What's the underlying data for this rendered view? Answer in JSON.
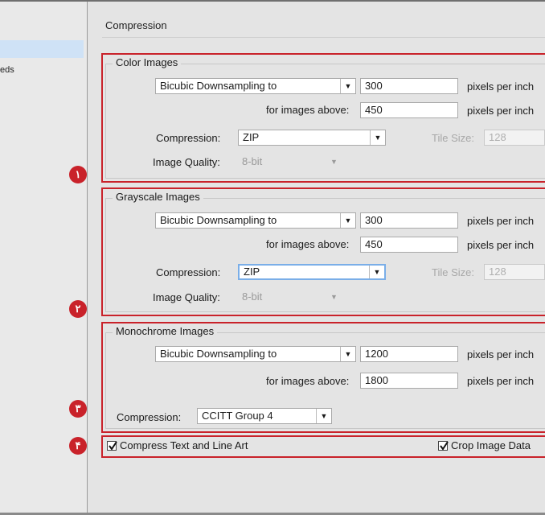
{
  "sidebar": {
    "item_partial": "eds"
  },
  "header": {
    "title": "Compression"
  },
  "color": {
    "title": "Color Images",
    "downsampling": "Bicubic Downsampling to",
    "resolution": "300",
    "res_unit": "pixels per inch",
    "above_label": "for images above:",
    "above_value": "450",
    "above_unit": "pixels per inch",
    "compression_label": "Compression:",
    "compression_value": "ZIP",
    "tile_label": "Tile Size:",
    "tile_value": "128",
    "quality_label": "Image Quality:",
    "quality_value": "8-bit",
    "badge": "١"
  },
  "gray": {
    "title": "Grayscale Images",
    "downsampling": "Bicubic Downsampling to",
    "resolution": "300",
    "res_unit": "pixels per inch",
    "above_label": "for images above:",
    "above_value": "450",
    "above_unit": "pixels per inch",
    "compression_label": "Compression:",
    "compression_value": "ZIP",
    "tile_label": "Tile Size:",
    "tile_value": "128",
    "quality_label": "Image Quality:",
    "quality_value": "8-bit",
    "badge": "٢"
  },
  "mono": {
    "title": "Monochrome Images",
    "downsampling": "Bicubic Downsampling to",
    "resolution": "1200",
    "res_unit": "pixels per inch",
    "above_label": "for images above:",
    "above_value": "1800",
    "above_unit": "pixels per inch",
    "compression_label": "Compression:",
    "compression_value": "CCITT Group 4",
    "badge": "٣"
  },
  "options": {
    "compress_text": "Compress Text and Line Art",
    "compress_text_checked": true,
    "crop_image": "Crop Image Data",
    "crop_image_checked": true,
    "badge": "۴"
  },
  "colors": {
    "highlight_red": "#c9222a",
    "panel_bg": "#e4e4e4"
  }
}
